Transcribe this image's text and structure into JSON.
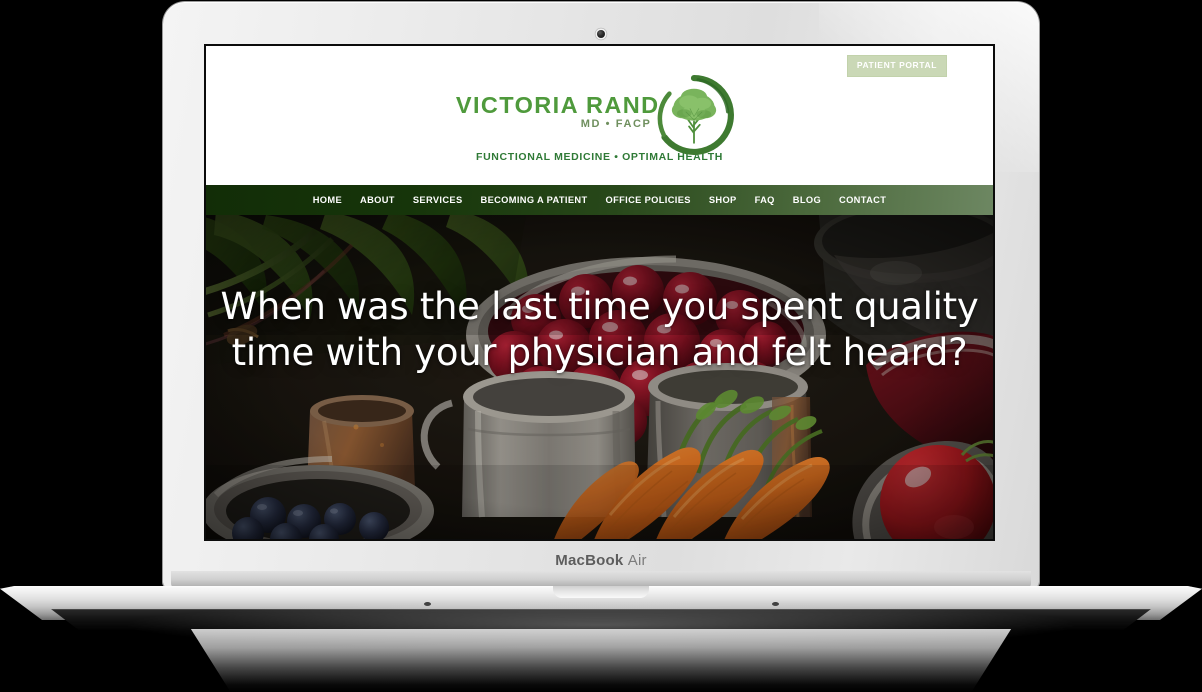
{
  "device": {
    "model_label_bold": "MacBook",
    "model_label_light": "Air",
    "camera_icon": "camera-dot-icon"
  },
  "site": {
    "header": {
      "patient_portal_label": "PATIENT PORTAL",
      "logo": {
        "name": "VICTORIA RAND",
        "credentials": "MD • FACP",
        "tagline": "FUNCTIONAL MEDICINE • OPTIMAL HEALTH",
        "mark_icon": "tree-in-circle-logo-icon",
        "name_color": "#4f9a3c",
        "credentials_color": "#6f8f5e",
        "tagline_color": "#2f7a36"
      }
    },
    "nav": {
      "items": [
        {
          "label": "HOME"
        },
        {
          "label": "ABOUT"
        },
        {
          "label": "SERVICES"
        },
        {
          "label": "BECOMING A PATIENT"
        },
        {
          "label": "OFFICE POLICIES"
        },
        {
          "label": "SHOP"
        },
        {
          "label": "FAQ"
        },
        {
          "label": "BLOG"
        },
        {
          "label": "CONTACT"
        }
      ],
      "gradient_start": "#122d07",
      "gradient_end": "#6d8762"
    },
    "hero": {
      "heading_line_1": "When was the last time you spent quality",
      "heading_line_2": "time with your physician and felt heard?",
      "image_description": "still-life-vegetables-photo",
      "text_color": "#ffffff"
    }
  }
}
